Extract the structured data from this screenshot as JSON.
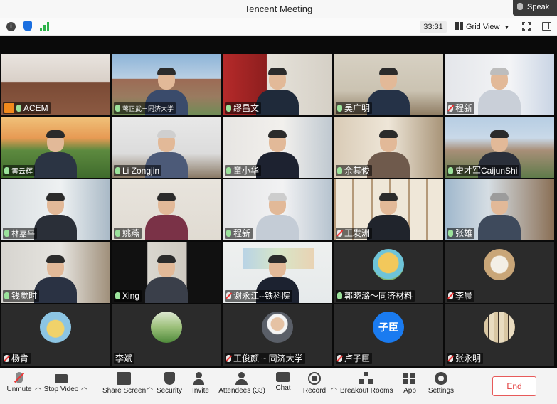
{
  "window": {
    "title": "Tencent Meeting",
    "speaker_label": "Speak"
  },
  "infobar": {
    "timer": "33:31",
    "view_label": "Grid View"
  },
  "participants": [
    {
      "name": "ACEM",
      "mic": "on",
      "host": true
    },
    {
      "name": "蒋正武－同济大学",
      "mic": "on"
    },
    {
      "name": "缪昌文",
      "mic": "on"
    },
    {
      "name": "吴广明",
      "mic": "on"
    },
    {
      "name": "程新",
      "mic": "muted"
    },
    {
      "name": "黄云辉",
      "mic": "on"
    },
    {
      "name": "Li Zongjin",
      "mic": "on"
    },
    {
      "name": "童小华",
      "mic": "on"
    },
    {
      "name": "余其俊",
      "mic": "on"
    },
    {
      "name": "史才军CaijunShi",
      "mic": "on"
    },
    {
      "name": "林嘉平",
      "mic": "on"
    },
    {
      "name": "姚燕",
      "mic": "on"
    },
    {
      "name": "程新",
      "mic": "on"
    },
    {
      "name": "王发洲",
      "mic": "muted"
    },
    {
      "name": "张雄",
      "mic": "on"
    },
    {
      "name": "钱觉时",
      "mic": "on"
    },
    {
      "name": "Xing",
      "mic": "on"
    },
    {
      "name": "谢永江--铁科院",
      "mic": "muted"
    },
    {
      "name": "郭晓潞～同济材料",
      "mic": "on"
    },
    {
      "name": "李晨",
      "mic": "muted"
    },
    {
      "name": "杨肯",
      "mic": "muted"
    },
    {
      "name": "李斌",
      "mic": "none"
    },
    {
      "name": "王俊颜 ~ 同济大学",
      "mic": "muted"
    },
    {
      "name": "卢子臣",
      "mic": "muted"
    },
    {
      "name": "张永明",
      "mic": "muted"
    }
  ],
  "avatar_text": {
    "lu_zichen": "子臣"
  },
  "toolbar": {
    "unmute": "Unmute",
    "stop_video": "Stop Video",
    "share_screen": "Share Screen",
    "security": "Security",
    "invite": "Invite",
    "attendees": "Attendees (33)",
    "chat": "Chat",
    "record": "Record",
    "breakout_rooms": "Breakout Rooms",
    "app": "App",
    "settings": "Settings",
    "end": "End"
  },
  "colors": {
    "end_red": "#e23b3b",
    "host_badge": "#f28a1c",
    "avatar_blue": "#1a7bf0"
  }
}
